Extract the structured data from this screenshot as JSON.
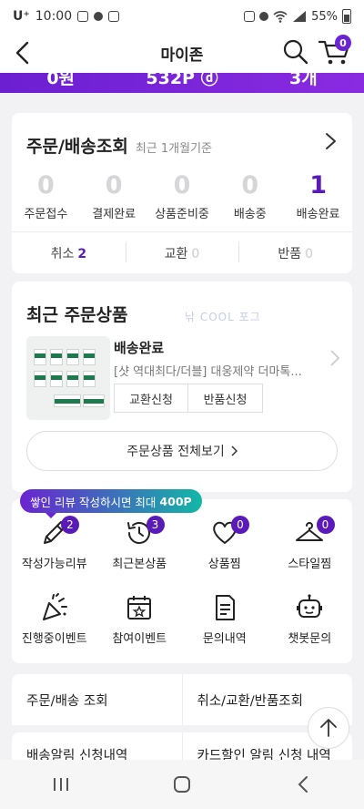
{
  "status_bar": {
    "carrier": "U⁺",
    "time": "10:00",
    "battery": "55%"
  },
  "header": {
    "title": "마이존",
    "cart_count": "0"
  },
  "stats": [
    "0원",
    "532P ⓓ",
    "3개"
  ],
  "order": {
    "title": "주문/배송조회",
    "subtitle": "최근 1개월기준",
    "steps": [
      {
        "count": "0",
        "label": "주문접수"
      },
      {
        "count": "0",
        "label": "결제완료"
      },
      {
        "count": "0",
        "label": "상품준비중"
      },
      {
        "count": "0",
        "label": "배송중"
      },
      {
        "count": "1",
        "label": "배송완료"
      }
    ],
    "footer": [
      {
        "label": "취소",
        "count": "2"
      },
      {
        "label": "교환",
        "count": "0"
      },
      {
        "label": "반품",
        "count": "0"
      }
    ]
  },
  "recent": {
    "title": "최근 주문상품",
    "watermark": "낚 COOL 포그",
    "status": "배송완료",
    "product_name": "[샷 역대최다/더블] 대웅제약 더마톡...",
    "exchange_label": "교환신청",
    "return_label": "반품신청",
    "view_all_label": "주문상품 전체보기"
  },
  "review_tooltip": {
    "text": "쌓인 리뷰 작성하시면 최대",
    "points": "400P"
  },
  "menu": [
    {
      "label": "작성가능리뷰",
      "badge": "2",
      "icon": "pencil-icon"
    },
    {
      "label": "최근본상품",
      "badge": "3",
      "icon": "history-icon"
    },
    {
      "label": "상품찜",
      "badge": "0",
      "icon": "heart-icon"
    },
    {
      "label": "스타일찜",
      "badge": "0",
      "icon": "hanger-icon"
    },
    {
      "label": "진행중이벤트",
      "badge": "",
      "icon": "party-icon"
    },
    {
      "label": "참여이벤트",
      "badge": "",
      "icon": "calendar-star-icon"
    },
    {
      "label": "문의내역",
      "badge": "",
      "icon": "document-icon"
    },
    {
      "label": "챗봇문의",
      "badge": "",
      "icon": "chatbot-icon"
    }
  ],
  "links": [
    "주문/배송 조회",
    "취소/교환/반품조회"
  ],
  "links2": [
    "배송알림 신청내역",
    "카드할인 알림 신청 내역"
  ]
}
